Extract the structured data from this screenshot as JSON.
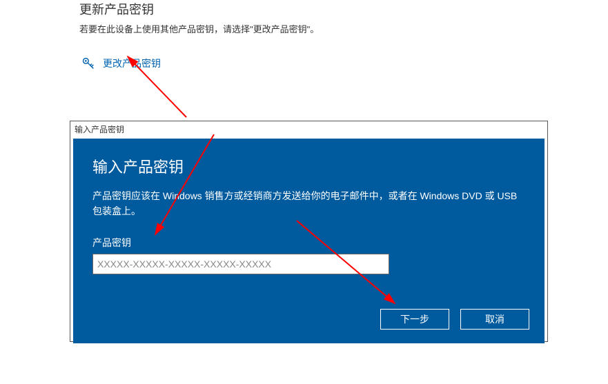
{
  "settings": {
    "heading": "更新产品密钥",
    "description": "若要在此设备上使用其他产品密钥，请选择\"更改产品密钥\"。",
    "change_key_link": "更改产品密钥"
  },
  "dialog": {
    "titlebar": "输入产品密钥",
    "heading": "输入产品密钥",
    "description": "产品密钥应该在 Windows 销售方或经销商方发送给你的电子邮件中，或者在 Windows DVD 或 USB 包装盒上。",
    "input_label": "产品密钥",
    "input_placeholder": "XXXXX-XXXXX-XXXXX-XXXXX-XXXXX",
    "next_button": "下一步",
    "cancel_button": "取消"
  }
}
